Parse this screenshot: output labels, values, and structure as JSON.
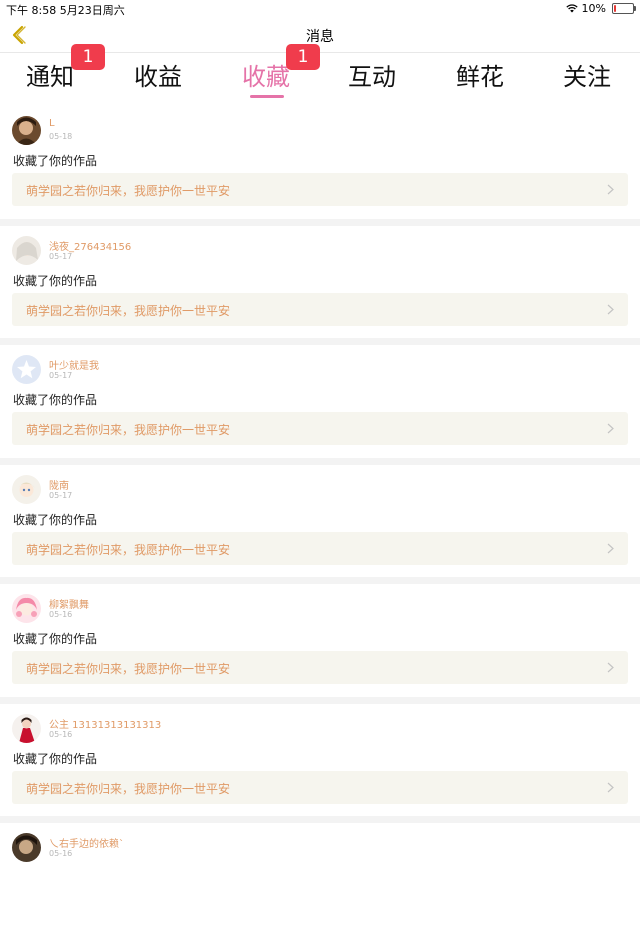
{
  "status_bar": {
    "time": "下午 8:58   5月23日周六",
    "battery": "10%",
    "battery_level": 0.1
  },
  "nav": {
    "title": "消息"
  },
  "tabs": [
    {
      "label": "通知",
      "badge": "1"
    },
    {
      "label": "收益",
      "badge": ""
    },
    {
      "label": "收藏",
      "badge": "1",
      "active": true
    },
    {
      "label": "互动",
      "badge": ""
    },
    {
      "label": "鲜花",
      "badge": ""
    },
    {
      "label": "关注",
      "badge": ""
    }
  ],
  "colors": {
    "accent": "#e573a8",
    "badge": "#f03c4c",
    "username": "#e09a66",
    "work_bg": "#f6f5ee"
  },
  "feed": [
    {
      "user": "L",
      "date": "05-18",
      "action": "收藏了你的作品",
      "work": "萌学园之若你归来，我愿护你一世平安"
    },
    {
      "user": "浅夜_276434156",
      "date": "05-17",
      "action": "收藏了你的作品",
      "work": "萌学园之若你归来，我愿护你一世平安"
    },
    {
      "user": "叶少就是我",
      "date": "05-17",
      "action": "收藏了你的作品",
      "work": "萌学园之若你归来，我愿护你一世平安"
    },
    {
      "user": "陇南",
      "date": "05-17",
      "action": "收藏了你的作品",
      "work": "萌学园之若你归来，我愿护你一世平安"
    },
    {
      "user": "柳絮飘舞",
      "date": "05-16",
      "action": "收藏了你的作品",
      "work": "萌学园之若你归来，我愿护你一世平安"
    },
    {
      "user": "公主 13131313131313",
      "date": "05-16",
      "action": "收藏了你的作品",
      "work": "萌学园之若你归来，我愿护你一世平安"
    },
    {
      "user": "乀右手边的依赖ˋ",
      "date": "05-16",
      "action": "",
      "work": ""
    }
  ]
}
